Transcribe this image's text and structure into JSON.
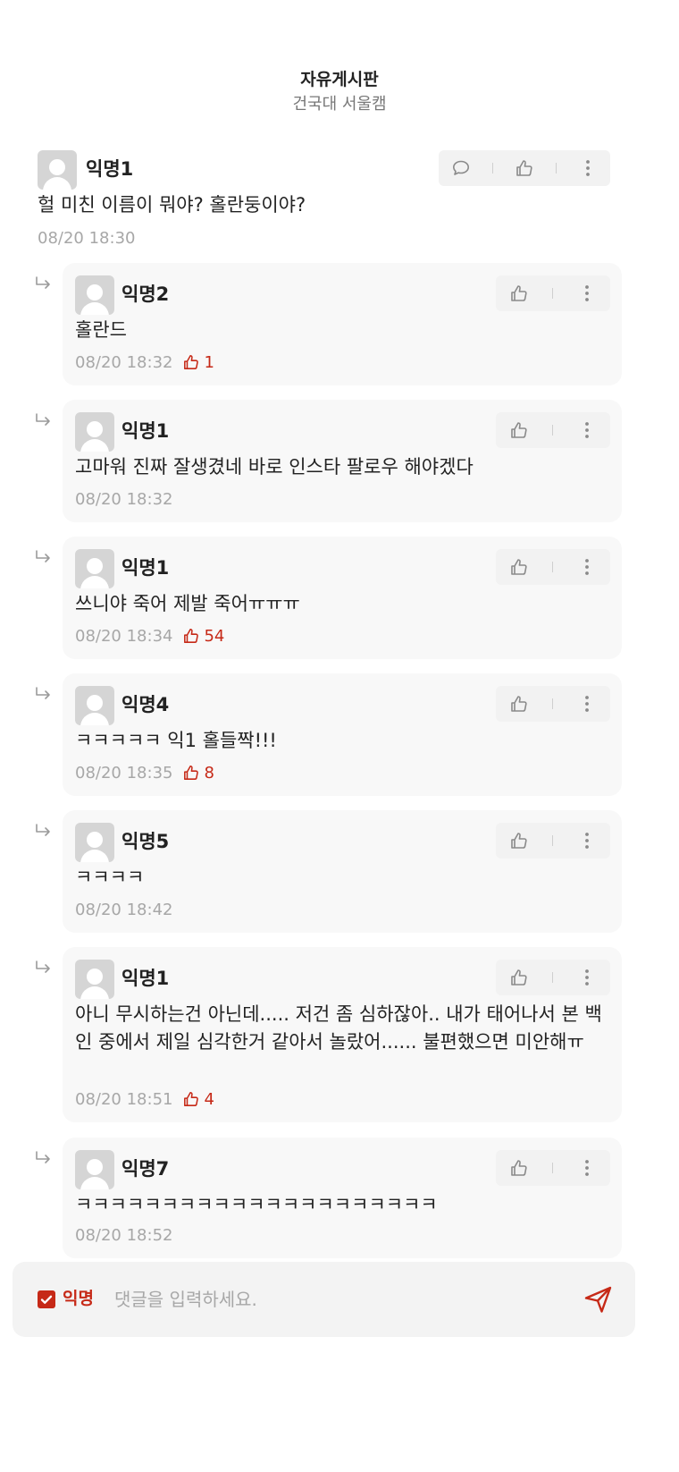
{
  "header": {
    "title": "자유게시판",
    "subtitle": "건국대 서울캠"
  },
  "post": {
    "author": "익명1",
    "text": "헐 미친 이름이 뭐야? 홀란둥이야?",
    "time": "08/20 18:30"
  },
  "replies": [
    {
      "author": "익명2",
      "text": "홀란드",
      "time": "08/20 18:32",
      "likes": "1"
    },
    {
      "author": "익명1",
      "text": "고마워 진짜 잘생겼네 바로 인스타 팔로우 해야겠다",
      "time": "08/20 18:32",
      "likes": null
    },
    {
      "author": "익명1",
      "text": "쓰니야 죽어 제발 죽어ㅠㅠㅠ",
      "time": "08/20 18:34",
      "likes": "54"
    },
    {
      "author": "익명4",
      "text": "ㅋㅋㅋㅋㅋ 익1 홀들짝!!!",
      "time": "08/20 18:35",
      "likes": "8"
    },
    {
      "author": "익명5",
      "text": "ㅋㅋㅋㅋ",
      "time": "08/20 18:42",
      "likes": null
    },
    {
      "author": "익명1",
      "text": "아니 무시하는건 아닌데..... 저건 좀 심하잖아.. 내가 태어나서 본 백인 중에서 제일 심각한거 같아서 놀랐어...... 불편했으면 미안해ㅠ",
      "time": "08/20 18:51",
      "likes": "4"
    },
    {
      "author": "익명7",
      "text": "ㅋㅋㅋㅋㅋㅋㅋㅋㅋㅋㅋㅋㅋㅋㅋㅋㅋㅋㅋㅋㅋ",
      "time": "08/20 18:52",
      "likes": null
    }
  ],
  "input": {
    "anonymous_label": "익명",
    "anonymous_checked": true,
    "placeholder": "댓글을 입력하세요."
  },
  "colors": {
    "accent": "#c62917",
    "muted": "#a7a7a7",
    "card": "#f8f8f8",
    "action_bg": "#f2f2f2"
  },
  "icons": {
    "comment": "speech-bubble-icon",
    "like": "thumbs-up-icon",
    "more": "vertical-dots-icon",
    "reply": "reply-arrow-icon",
    "send": "paper-plane-icon"
  }
}
